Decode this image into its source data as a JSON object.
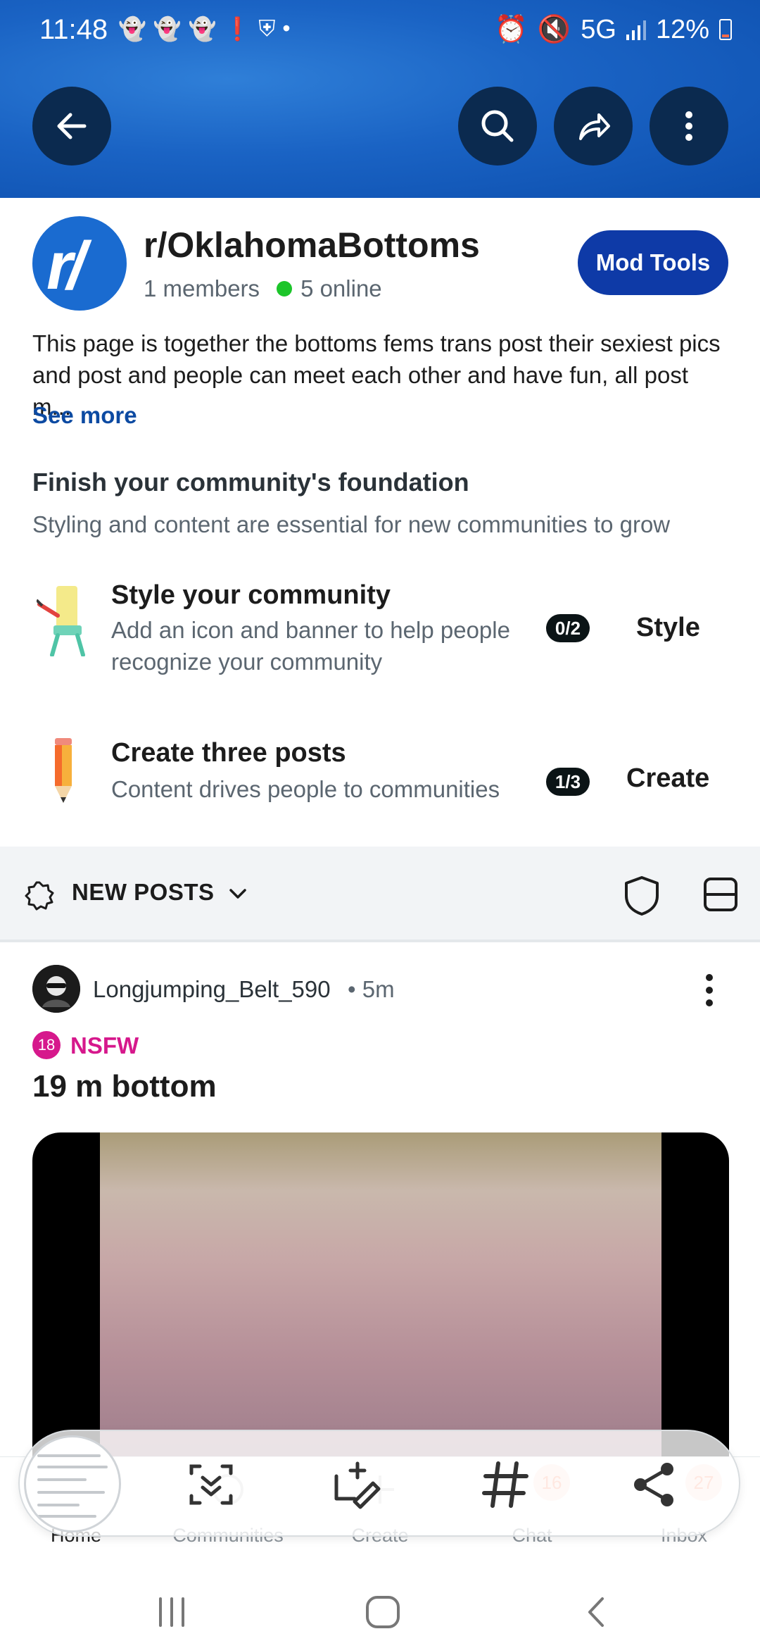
{
  "status_bar": {
    "time": "11:48",
    "network": "5G",
    "battery": "12%"
  },
  "header": {
    "back_icon": "arrow-left-icon",
    "search_icon": "search-icon",
    "share_icon": "share-arrow-icon",
    "more_icon": "more-vertical-icon"
  },
  "community": {
    "avatar_text": "r/",
    "name": "r/OklahomaBottoms",
    "members": "1 members",
    "online": "5 online",
    "mod_tools_label": "Mod Tools",
    "description": "This page is together the bottoms fems trans post their sexiest pics and post and people can meet each other and have fun, all post m...",
    "see_more": "See more"
  },
  "foundation": {
    "title": "Finish your community's foundation",
    "subtitle": "Styling and content are essential for new communities to grow",
    "tasks": [
      {
        "title": "Style your community",
        "description": "Add an icon and banner to help people recognize your community",
        "progress": "0/2",
        "action": "Style",
        "icon": "easel-icon"
      },
      {
        "title": "Create three posts",
        "description": "Content drives people to communities",
        "progress": "1/3",
        "action": "Create",
        "icon": "pencil-icon"
      }
    ]
  },
  "sort_bar": {
    "label": "NEW POSTS",
    "icons": [
      "gear-badge-icon",
      "chevron-down-icon",
      "shield-icon",
      "card-view-icon"
    ]
  },
  "post": {
    "username": "Longjumping_Belt_590",
    "time": "• 5m",
    "nsfw_badge": "18",
    "nsfw_label": "NSFW",
    "title": "19 m bottom"
  },
  "bottom_nav": {
    "items": [
      {
        "label": "Home",
        "icon": "home-icon"
      },
      {
        "label": "Communities",
        "icon": "communities-icon"
      },
      {
        "label": "Create",
        "icon": "plus-icon"
      },
      {
        "label": "Chat",
        "icon": "chat-icon",
        "count": "16"
      },
      {
        "label": "Inbox",
        "icon": "bell-icon",
        "count": "27"
      }
    ]
  },
  "overlay": {
    "icons": [
      "smart-select-icon",
      "draw-icon",
      "hashtag-icon",
      "share-icon"
    ]
  },
  "system_nav": {
    "icons": [
      "recents-icon",
      "home-circle-icon",
      "back-chevron-icon"
    ]
  }
}
